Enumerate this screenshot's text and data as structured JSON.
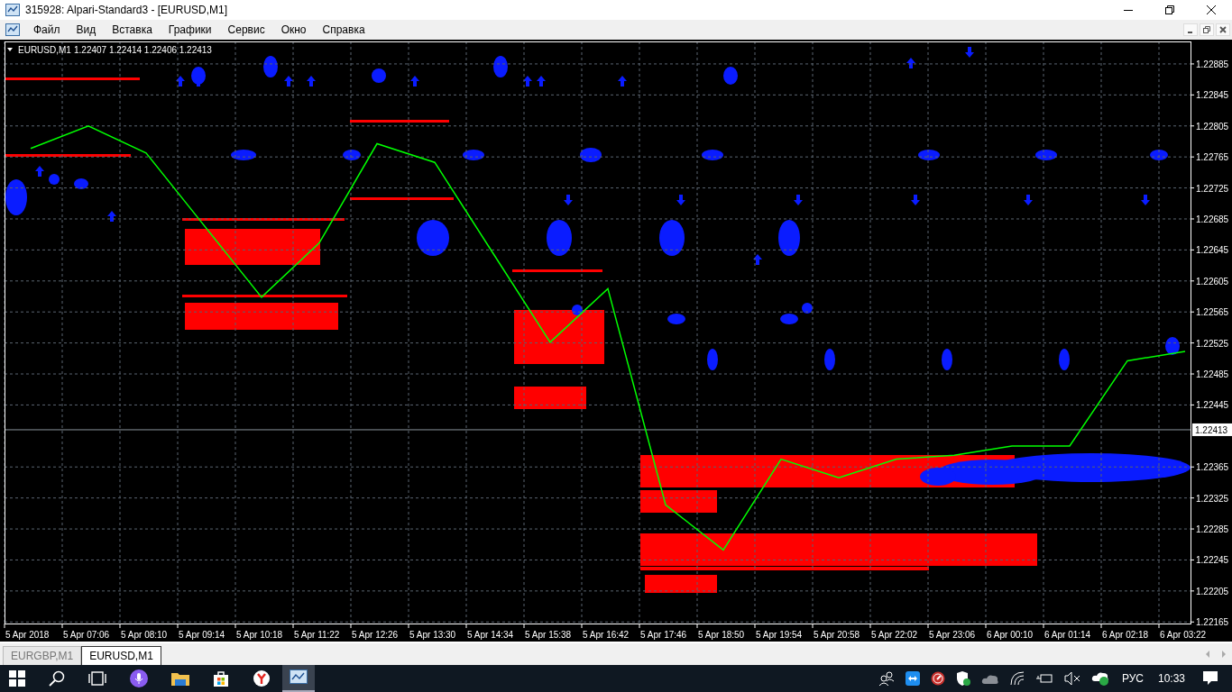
{
  "window": {
    "title": "315928: Alpari-Standard3 - [EURUSD,M1]"
  },
  "menu": [
    {
      "label": "Файл"
    },
    {
      "label": "Вид"
    },
    {
      "label": "Вставка"
    },
    {
      "label": "Графики"
    },
    {
      "label": "Сервис"
    },
    {
      "label": "Окно"
    },
    {
      "label": "Справка"
    }
  ],
  "chart": {
    "symbol": "EURUSD,M1",
    "quotes": "1.22407 1.22414 1.22406 1.22413",
    "current_price": "1.22413",
    "chart_data": {
      "type": "line",
      "grid": true,
      "ylim": [
        1.22163,
        1.22914
      ],
      "x": [
        "5 Apr 2018",
        "5 Apr 07:06",
        "5 Apr 08:10",
        "5 Apr 09:14",
        "5 Apr 10:18",
        "5 Apr 11:22",
        "5 Apr 12:26",
        "5 Apr 13:30",
        "5 Apr 14:34",
        "5 Apr 15:38",
        "5 Apr 16:42",
        "5 Apr 17:46",
        "5 Apr 18:50",
        "5 Apr 19:54",
        "5 Apr 20:58",
        "5 Apr 22:02",
        "5 Apr 23:06",
        "6 Apr 00:10",
        "6 Apr 01:14",
        "6 Apr 02:18",
        "6 Apr 03:22"
      ],
      "series": [
        {
          "color": "#00ff00",
          "values": [
            1.22776,
            1.22805,
            1.2277,
            1.22677,
            1.22584,
            1.22654,
            1.22782,
            1.22758,
            1.22642,
            1.22526,
            1.22595,
            1.22316,
            1.22258,
            1.22375,
            1.22351,
            1.22375,
            1.2238,
            1.22392,
            1.22392,
            1.22502,
            1.22514
          ]
        }
      ],
      "yticks": [
        1.22885,
        1.22845,
        1.22805,
        1.22765,
        1.22725,
        1.22685,
        1.22645,
        1.22605,
        1.22565,
        1.22525,
        1.22485,
        1.22445,
        1.22365,
        1.22325,
        1.22285,
        1.22245,
        1.22205,
        1.22165
      ]
    }
  },
  "tabs": [
    {
      "label": "EURGBP,M1",
      "selected": false
    },
    {
      "label": "EURUSD,M1",
      "selected": true
    }
  ],
  "taskbar": {
    "language": "РУС",
    "clock": "10:33"
  }
}
